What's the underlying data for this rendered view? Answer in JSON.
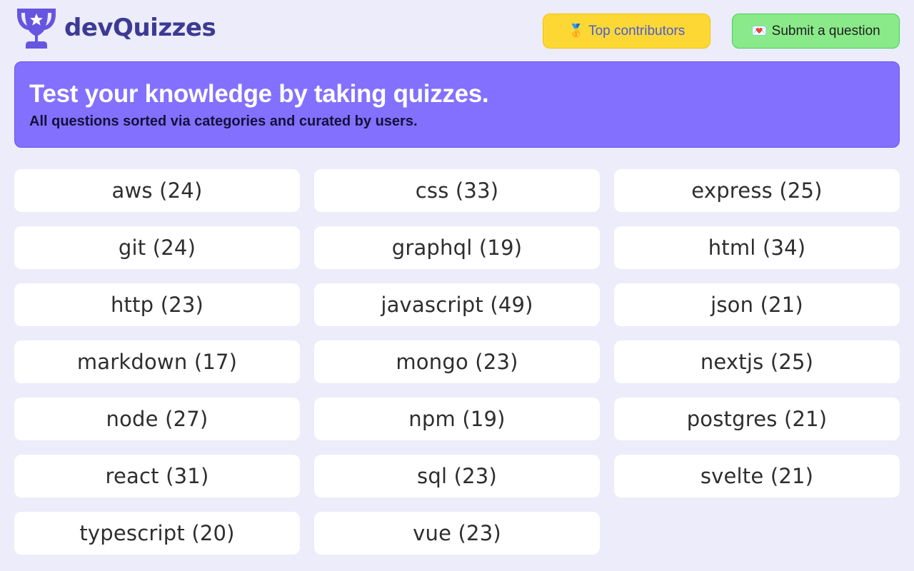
{
  "brand": {
    "name": "devQuizzes",
    "icon": "trophy-icon",
    "color": "#3d3a93"
  },
  "header": {
    "top_contributors": {
      "emoji": "🥇",
      "label": "Top contributors"
    },
    "submit_question": {
      "emoji": "💌",
      "label": "Submit a question"
    }
  },
  "hero": {
    "title": "Test your knowledge by taking quizzes.",
    "subtitle": "All questions sorted via categories and curated by users."
  },
  "categories": [
    "aws (24)",
    "css (33)",
    "express (25)",
    "git (24)",
    "graphql (19)",
    "html (34)",
    "http (23)",
    "javascript (49)",
    "json (21)",
    "markdown (17)",
    "mongo (23)",
    "nextjs (25)",
    "node (27)",
    "npm (19)",
    "postgres (21)",
    "react (31)",
    "sql (23)",
    "svelte (21)",
    "typescript (20)",
    "vue (23)"
  ],
  "colors": {
    "background": "#ececfa",
    "hero": "#8370fe",
    "contrib_button": "#fdd835",
    "submit_button": "#8aea8a"
  }
}
